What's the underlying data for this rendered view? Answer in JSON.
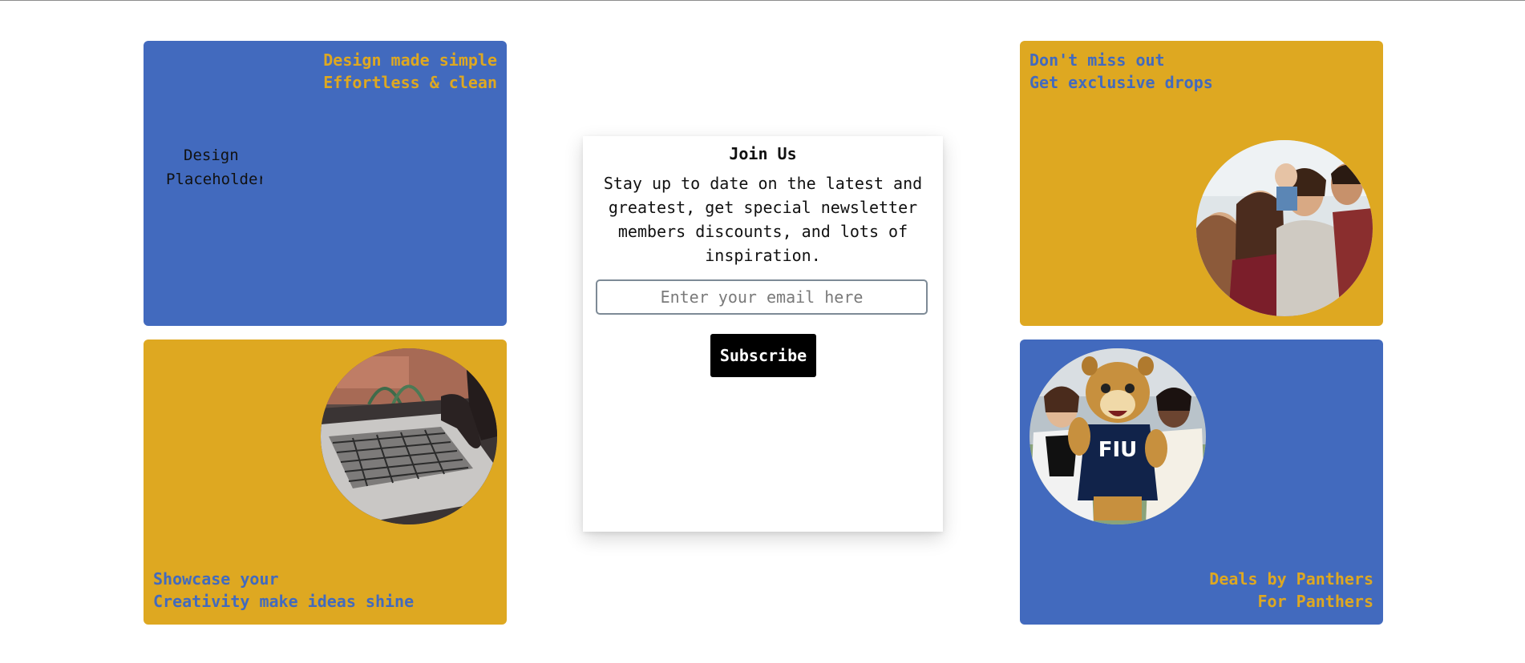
{
  "cards": {
    "top_left": {
      "line1": "Design made simple",
      "line2": "Effortless & clean",
      "broken_image_alt_line1": "Design",
      "broken_image_alt_line2": "Placeholder"
    },
    "bottom_left": {
      "line1": "Showcase your",
      "line2": "Creativity make ideas shine"
    },
    "top_right": {
      "line1": "Don't miss out",
      "line2": "Get exclusive drops"
    },
    "bottom_right": {
      "line1": "Deals by Panthers",
      "line2": "For Panthers",
      "jersey_text": "FIU"
    }
  },
  "signup": {
    "title": "Join Us",
    "description": "Stay up to date on the latest and greatest, get special newsletter members discounts, and lots of inspiration.",
    "email_placeholder": "Enter your email here",
    "subscribe_label": "Subscribe"
  },
  "colors": {
    "blue": "#426abe",
    "gold": "#dea821",
    "button": "#000000"
  }
}
